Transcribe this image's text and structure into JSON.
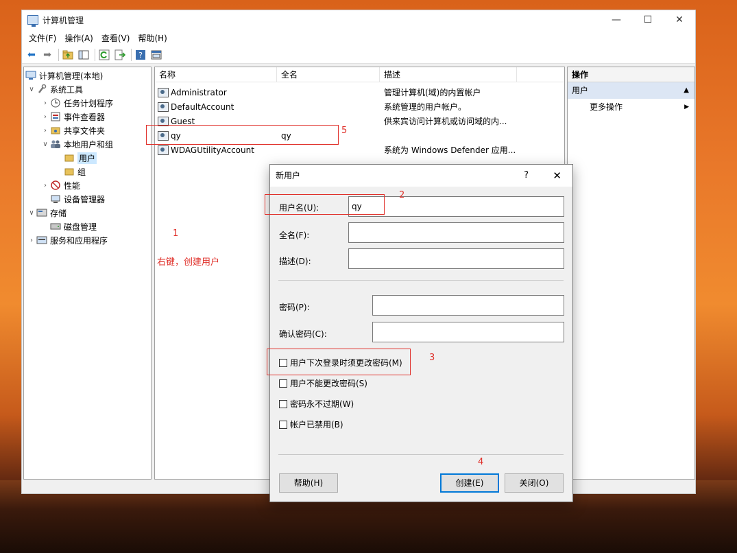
{
  "window": {
    "title": "计算机管理",
    "controls": {
      "minimize": "—",
      "maximize": "☐",
      "close": "✕"
    }
  },
  "menu": [
    "文件(F)",
    "操作(A)",
    "查看(V)",
    "帮助(H)"
  ],
  "toolbar": [
    "back-arrow-icon",
    "forward-arrow-icon",
    "folder-up-icon",
    "show-hide-tree-icon",
    "refresh-icon",
    "export-list-icon",
    "help-icon",
    "properties-icon"
  ],
  "tree": {
    "root": "计算机管理(本地)",
    "system_tools": "系统工具",
    "task_scheduler": "任务计划程序",
    "event_viewer": "事件查看器",
    "shared_folders": "共享文件夹",
    "local_users_groups": "本地用户和组",
    "users": "用户",
    "groups": "组",
    "performance": "性能",
    "device_manager": "设备管理器",
    "storage": "存储",
    "disk_management": "磁盘管理",
    "services_apps": "服务和应用程序"
  },
  "list": {
    "headers": [
      "名称",
      "全名",
      "描述"
    ],
    "rows": [
      {
        "name": "Administrator",
        "fullname": "",
        "desc": "管理计算机(域)的内置帐户"
      },
      {
        "name": "DefaultAccount",
        "fullname": "",
        "desc": "系统管理的用户帐户。"
      },
      {
        "name": "Guest",
        "fullname": "",
        "desc": "供来宾访问计算机或访问域的内..."
      },
      {
        "name": "qy",
        "fullname": "qy",
        "desc": ""
      },
      {
        "name": "WDAGUtilityAccount",
        "fullname": "",
        "desc": "系统为 Windows Defender 应用..."
      }
    ]
  },
  "actions": {
    "header": "操作",
    "group": "用户",
    "more": "更多操作"
  },
  "dialog": {
    "title": "新用户",
    "help_glyph": "?",
    "close_glyph": "✕",
    "username_label": "用户名(U):",
    "username_value": "qy",
    "fullname_label": "全名(F):",
    "fullname_value": "",
    "desc_label": "描述(D):",
    "desc_value": "",
    "password_label": "密码(P):",
    "confirm_label": "确认密码(C):",
    "chk_must_change": "用户下次登录时须更改密码(M)",
    "chk_cannot_change": "用户不能更改密码(S)",
    "chk_never_expires": "密码永不过期(W)",
    "chk_disabled": "帐户已禁用(B)",
    "help_button": "帮助(H)",
    "create_button": "创建(E)",
    "close_button": "关闭(O)"
  },
  "annotations": {
    "n1": "1",
    "hint": "右键，创建用户",
    "n2": "2",
    "n3": "3",
    "n4": "4",
    "n5": "5",
    "color": "#e0302a"
  }
}
